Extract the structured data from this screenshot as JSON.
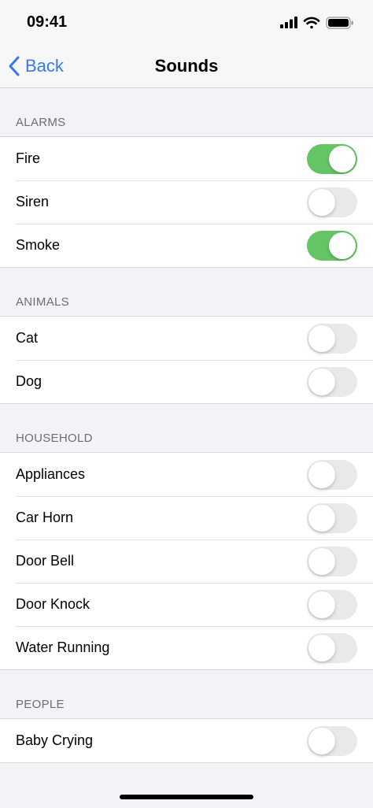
{
  "status_bar": {
    "time": "09:41"
  },
  "nav": {
    "back_label": "Back",
    "title": "Sounds"
  },
  "colors": {
    "accent": "#3478f6",
    "toggle_on": "#65c466",
    "toggle_off": "#e9e9ea"
  },
  "sections": [
    {
      "header": "ALARMS",
      "items": [
        {
          "label": "Fire",
          "on": true
        },
        {
          "label": "Siren",
          "on": false
        },
        {
          "label": "Smoke",
          "on": true
        }
      ]
    },
    {
      "header": "ANIMALS",
      "items": [
        {
          "label": "Cat",
          "on": false
        },
        {
          "label": "Dog",
          "on": false
        }
      ]
    },
    {
      "header": "HOUSEHOLD",
      "items": [
        {
          "label": "Appliances",
          "on": false
        },
        {
          "label": "Car Horn",
          "on": false
        },
        {
          "label": "Door Bell",
          "on": false
        },
        {
          "label": "Door Knock",
          "on": false
        },
        {
          "label": "Water Running",
          "on": false
        }
      ]
    },
    {
      "header": "PEOPLE",
      "items": [
        {
          "label": "Baby Crying",
          "on": false
        }
      ]
    }
  ]
}
